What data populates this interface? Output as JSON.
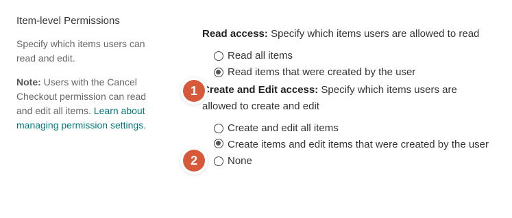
{
  "panel": {
    "title": "Item-level Permissions",
    "description": "Specify which items users can read and edit.",
    "note_label": "Note:",
    "note_text": " Users with the Cancel Checkout permission can read and edit all items. ",
    "note_link": "Learn about managing permission settings."
  },
  "read_access": {
    "heading_label": "Read access:",
    "heading_text": "  Specify which items users are allowed to read",
    "options": [
      {
        "label": "Read all items",
        "selected": false
      },
      {
        "label": "Read items that were created by the user",
        "selected": true
      }
    ]
  },
  "edit_access": {
    "heading_label": "Create and Edit access:",
    "heading_text": "  Specify which items users are allowed to create and edit",
    "options": [
      {
        "label": "Create and edit all items",
        "selected": false
      },
      {
        "label": "Create items and edit items that were created by the user",
        "selected": true
      },
      {
        "label": "None",
        "selected": false
      }
    ]
  },
  "callouts": [
    "1",
    "2"
  ],
  "colors": {
    "callout": "#d65a3a",
    "link": "#03787c"
  }
}
